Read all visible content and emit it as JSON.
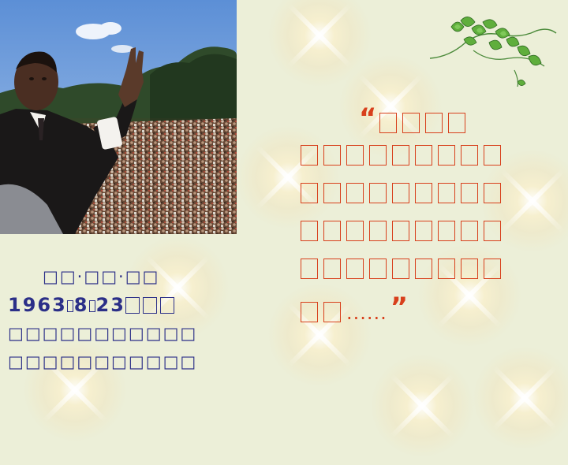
{
  "caption": {
    "name_line": "□□·□□·□□",
    "date_year": "1963",
    "date_month": "8",
    "date_day": "23",
    "line3": "□□□□□□□□□□□",
    "line4": "□□□□□□□□□□□"
  },
  "quote": {
    "open_mark": "“",
    "close_mark": "”",
    "ellipsis": "......"
  },
  "colors": {
    "background": "#ecefd8",
    "caption_text": "#2b2f88",
    "quote_text": "#d8401c"
  }
}
